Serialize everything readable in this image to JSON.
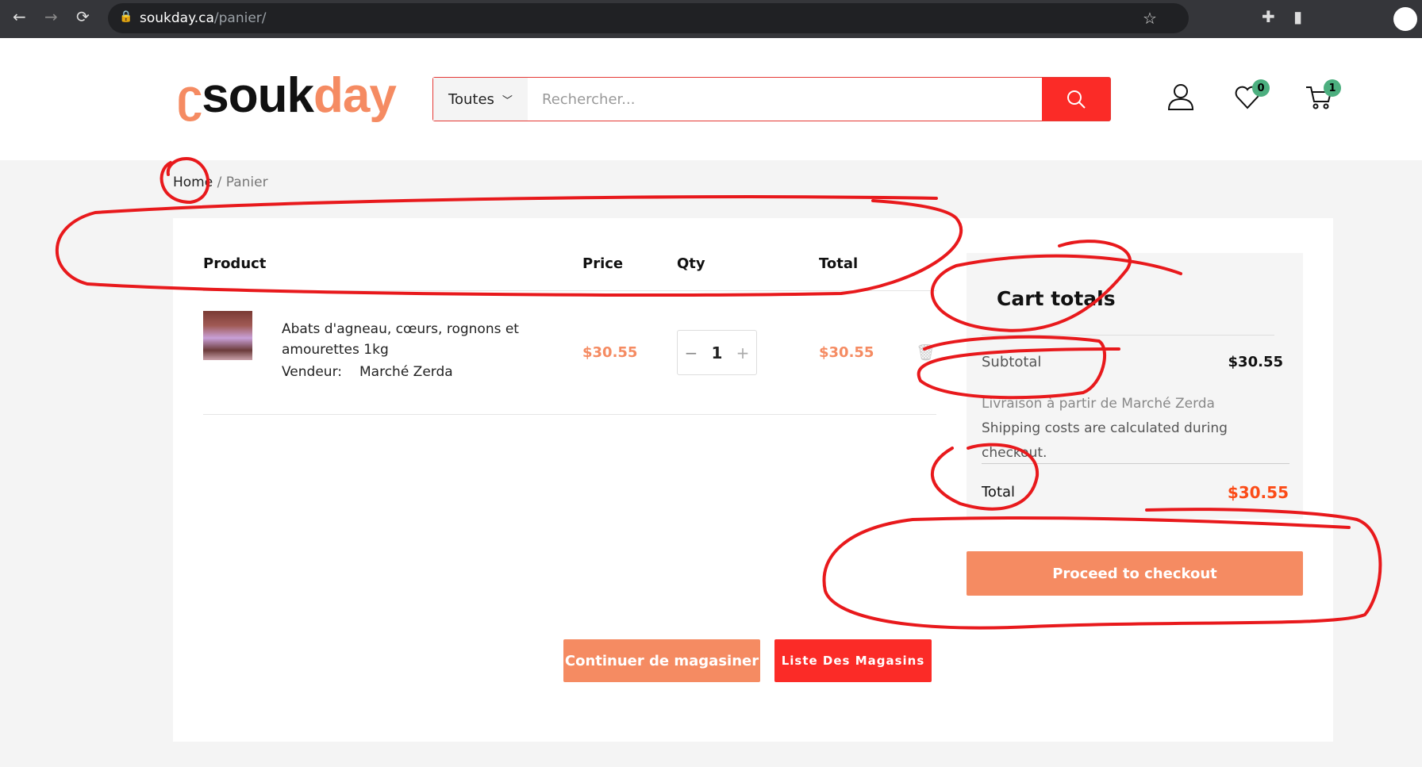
{
  "browser": {
    "url_host": "soukday.ca",
    "url_path": "/panier/"
  },
  "header": {
    "logo_part1": "souk",
    "logo_part2": "day",
    "category": "Toutes",
    "search_placeholder": "Rechercher...",
    "wishlist_count": "0",
    "cart_count": "1"
  },
  "breadcrumb": {
    "home": "Home",
    "separator": " / ",
    "current": "Panier"
  },
  "cart": {
    "columns": [
      "Product",
      "Price",
      "Qty",
      "Total"
    ],
    "items": [
      {
        "name_line1": "Abats d'agneau, cœurs, rognons et",
        "name_line2": "amourettes 1kg",
        "vendor_label": "Vendeur:",
        "vendor": "Marché Zerda",
        "price": "$30.55",
        "qty": "1",
        "total": "$30.55"
      }
    ]
  },
  "totals": {
    "title": "Cart totals",
    "subtotal_label": "Subtotal",
    "subtotal": "$30.55",
    "shipping_from": "Livraison à partir de Marché Zerda",
    "shipping_note_1": "Shipping costs are calculated during",
    "shipping_note_2": "checkout.",
    "total_label": "Total",
    "total": "$30.55",
    "checkout": "Proceed to checkout"
  },
  "actions": {
    "continue": "Continuer de magasiner",
    "stores": "Liste Des Magasins"
  },
  "colors": {
    "accent": "#f58b62",
    "red": "#fb2b27",
    "annotation": "#e8191c"
  }
}
